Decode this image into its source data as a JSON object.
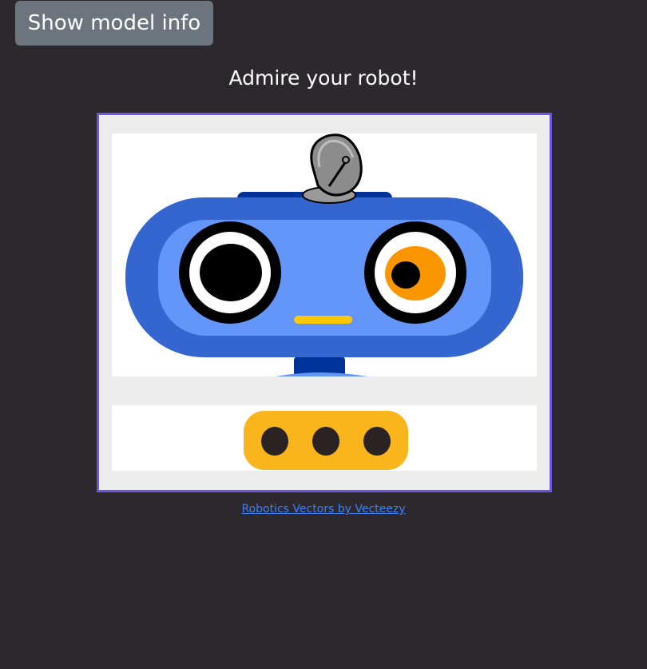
{
  "toolbar": {
    "model_info_label": "Show model info"
  },
  "main": {
    "heading": "Admire your robot!",
    "credit_link": "Robotics Vectors by Vecteezy"
  },
  "robot": {
    "head_icon": "robot-head-icon",
    "body_icon": "robot-body-icon",
    "colors": {
      "frame_border": "#7153e8",
      "head_outer": "#3566cf",
      "head_inner": "#6496f9",
      "antenna_bar": "#003399",
      "dish": "#999999",
      "eye_ring": "#000000",
      "right_iris": "#fa9600",
      "mouth": "#ffc800",
      "body_panel": "#fbb51c",
      "body_dot": "#2a2324"
    }
  }
}
